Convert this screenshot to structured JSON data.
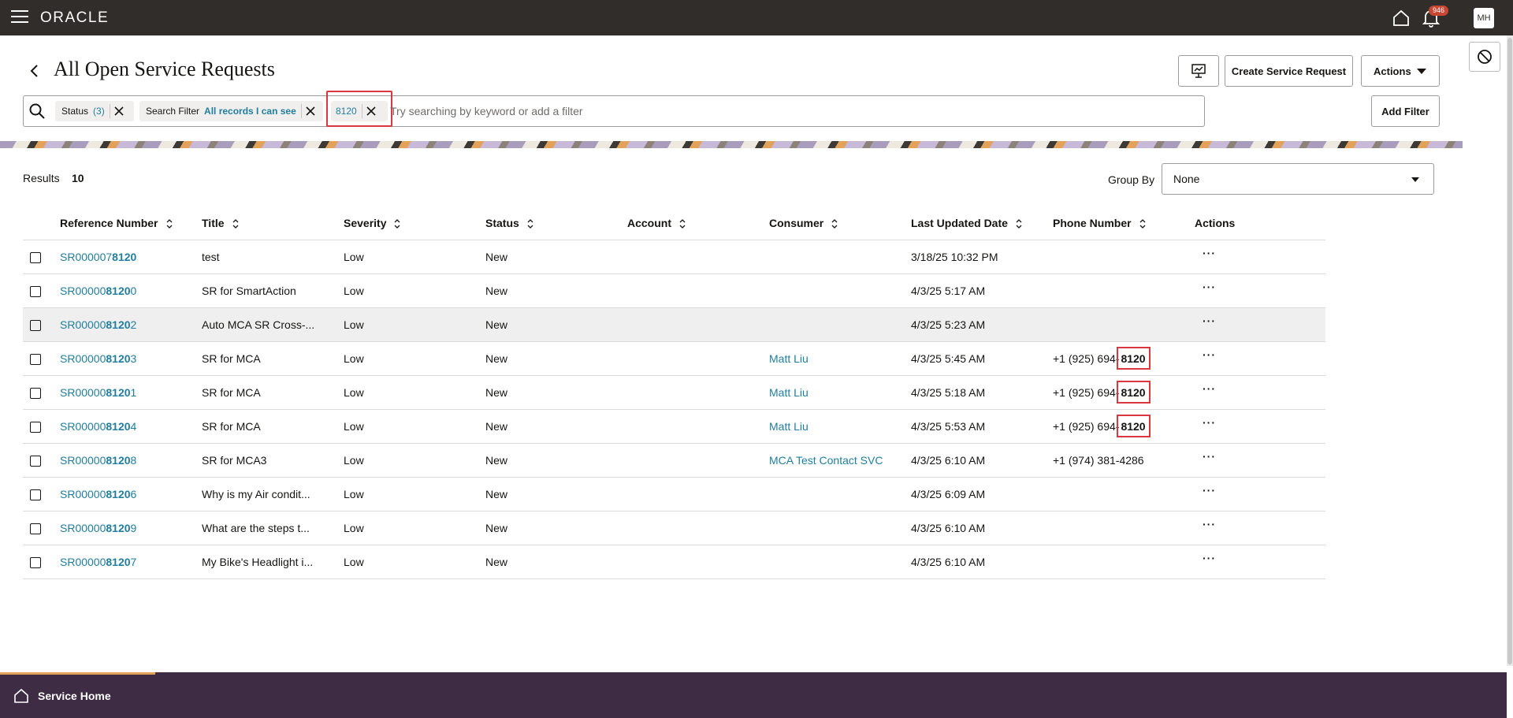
{
  "topbar": {
    "logo": "ORACLE",
    "notification_count": "946",
    "avatar_initials": "MH"
  },
  "page": {
    "title": "All Open Service Requests"
  },
  "toolbar": {
    "create_label": "Create Service Request",
    "actions_label": "Actions",
    "add_filter_label": "Add Filter"
  },
  "search": {
    "placeholder": "Try searching by keyword or add a filter",
    "chips": [
      {
        "label": "Status",
        "value": "(3)"
      },
      {
        "label": "Search Filter",
        "value": "All records I can see"
      },
      {
        "label": "",
        "value": "8120"
      }
    ]
  },
  "results": {
    "label": "Results",
    "count": "10"
  },
  "group_by": {
    "label": "Group By",
    "value": "None"
  },
  "table": {
    "headers": [
      "Reference Number",
      "Title",
      "Severity",
      "Status",
      "Account",
      "Consumer",
      "Last Updated Date",
      "Phone Number",
      "Actions"
    ],
    "rows": [
      {
        "ref_prefix": "SR000007",
        "ref_match": "8120",
        "ref_suffix": "",
        "title": "test",
        "severity": "Low",
        "status": "New",
        "account": "",
        "consumer": "",
        "date": "3/18/25 10:32 PM",
        "phone_prefix": "",
        "phone_match": ""
      },
      {
        "ref_prefix": "SR00000",
        "ref_match": "8120",
        "ref_suffix": "0",
        "title": "SR for SmartAction",
        "severity": "Low",
        "status": "New",
        "account": "",
        "consumer": "",
        "date": "4/3/25 5:17 AM",
        "phone_prefix": "",
        "phone_match": ""
      },
      {
        "ref_prefix": "SR00000",
        "ref_match": "8120",
        "ref_suffix": "2",
        "title": "Auto MCA SR Cross-...",
        "severity": "Low",
        "status": "New",
        "account": "",
        "consumer": "",
        "date": "4/3/25 5:23 AM",
        "phone_prefix": "",
        "phone_match": ""
      },
      {
        "ref_prefix": "SR00000",
        "ref_match": "8120",
        "ref_suffix": "3",
        "title": "SR for MCA",
        "severity": "Low",
        "status": "New",
        "account": "",
        "consumer": "Matt Liu",
        "date": "4/3/25 5:45 AM",
        "phone_prefix": "+1 (925) 694-",
        "phone_match": "8120"
      },
      {
        "ref_prefix": "SR00000",
        "ref_match": "8120",
        "ref_suffix": "1",
        "title": "SR for MCA",
        "severity": "Low",
        "status": "New",
        "account": "",
        "consumer": "Matt Liu",
        "date": "4/3/25 5:18 AM",
        "phone_prefix": "+1 (925) 694-",
        "phone_match": "8120"
      },
      {
        "ref_prefix": "SR00000",
        "ref_match": "8120",
        "ref_suffix": "4",
        "title": "SR for MCA",
        "severity": "Low",
        "status": "New",
        "account": "",
        "consumer": "Matt Liu",
        "date": "4/3/25 5:53 AM",
        "phone_prefix": "+1 (925) 694-",
        "phone_match": "8120"
      },
      {
        "ref_prefix": "SR00000",
        "ref_match": "8120",
        "ref_suffix": "8",
        "title": "SR for MCA3",
        "severity": "Low",
        "status": "New",
        "account": "",
        "consumer": "MCA Test Contact SVC",
        "date": "4/3/25 6:10 AM",
        "phone_prefix": "+1 (974) 381-4286",
        "phone_match": ""
      },
      {
        "ref_prefix": "SR00000",
        "ref_match": "8120",
        "ref_suffix": "6",
        "title": "Why is my Air condit...",
        "severity": "Low",
        "status": "New",
        "account": "",
        "consumer": "",
        "date": "4/3/25 6:09 AM",
        "phone_prefix": "",
        "phone_match": ""
      },
      {
        "ref_prefix": "SR00000",
        "ref_match": "8120",
        "ref_suffix": "9",
        "title": "What are the steps t...",
        "severity": "Low",
        "status": "New",
        "account": "",
        "consumer": "",
        "date": "4/3/25 6:10 AM",
        "phone_prefix": "",
        "phone_match": ""
      },
      {
        "ref_prefix": "SR00000",
        "ref_match": "8120",
        "ref_suffix": "7",
        "title": "My Bike's Headlight i...",
        "severity": "Low",
        "status": "New",
        "account": "",
        "consumer": "",
        "date": "4/3/25 6:10 AM",
        "phone_prefix": "",
        "phone_match": ""
      }
    ],
    "row_action": "···"
  },
  "footer": {
    "home_label": "Service Home"
  },
  "colors": {
    "topbar": "#312d2a",
    "link": "#227e9e",
    "highlight": "#d9383f",
    "footer": "#3d2c43"
  }
}
